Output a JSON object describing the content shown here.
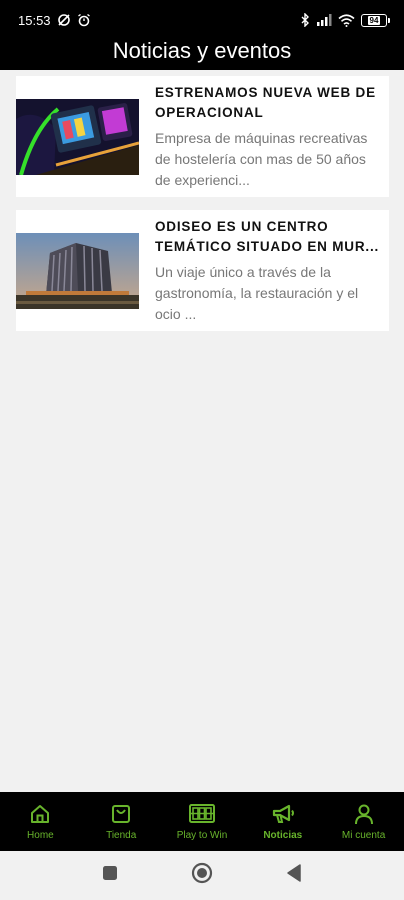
{
  "status_bar": {
    "time": "15:53",
    "battery": "94"
  },
  "header": {
    "title": "Noticias y eventos"
  },
  "news": [
    {
      "title": "ESTRENAMOS NUEVA WEB DE OPERACIONAL",
      "description": "Empresa de máquinas recreativas de hostelería con mas de 50 años de experienci...",
      "image_icon": "slot-machine-photo"
    },
    {
      "title": "ODISEO ES UN CENTRO TEMÁTICO SITUADO EN MUR...",
      "description": "Un viaje único a través de la gastronomía, la restauración y el ocio ...",
      "image_icon": "building-photo"
    }
  ],
  "bottom_nav": {
    "items": [
      {
        "label": "Home",
        "icon": "home-icon"
      },
      {
        "label": "Tienda",
        "icon": "shopping-bag-icon"
      },
      {
        "label": "Play to Win",
        "icon": "slot-machine-icon"
      },
      {
        "label": "Noticias",
        "icon": "megaphone-icon",
        "active": true
      },
      {
        "label": "Mi cuenta",
        "icon": "user-icon"
      }
    ]
  },
  "colors": {
    "accent": "#68b42c",
    "header_bg": "#000000",
    "page_bg": "#f1f1f1"
  }
}
